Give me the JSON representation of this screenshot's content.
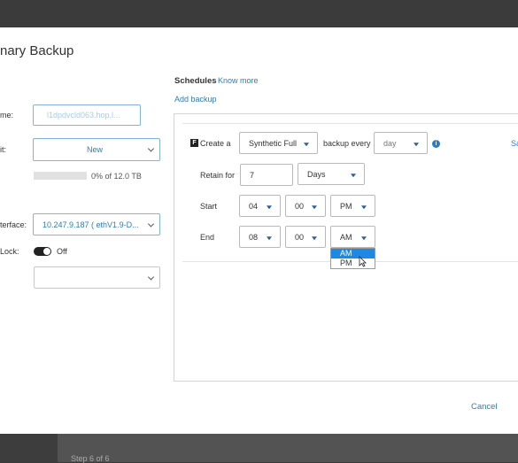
{
  "dialog": {
    "title": "nary Backup",
    "cancel_label": "Cancel"
  },
  "left": {
    "name_label": "me:",
    "name_value": "l1dpdvcld063.hop.l...",
    "unit_label": "it:",
    "unit_value": "New",
    "progress_percent": 0,
    "progress_text": "0% of 12.0 TB",
    "interface_label": "terface:",
    "interface_value": "10.247.9.187 ( ethV1.9-D...",
    "lock_label": "Lock:",
    "lock_toggle_text": "Off",
    "lock_select_value": ""
  },
  "schedules": {
    "title": "Schedules",
    "know_more": "Know more",
    "add_backup": "Add backup",
    "create_label": "Create a",
    "backup_type": "Synthetic Full",
    "backup_every_label": "backup every",
    "every_value": "day",
    "right_cut_text": "Sa",
    "retain_label": "Retain for",
    "retain_value": "7",
    "retain_unit": "Days",
    "start_label": "Start",
    "start_hour": "04",
    "start_min": "00",
    "start_ampm": "PM",
    "end_label": "End",
    "end_hour": "08",
    "end_min": "00",
    "end_ampm": "AM",
    "ampm_options": [
      "AM",
      "PM"
    ]
  },
  "footer": {
    "step_text": "Step 6 of 6"
  },
  "colors": {
    "accent": "#2c7cc0",
    "selected_option": "#1e88e5"
  },
  "icons": [
    "chevron-down-icon",
    "dropdown-triangle-icon",
    "info-icon",
    "f-badge-icon",
    "toggle-switch-icon",
    "mouse-cursor-icon"
  ]
}
